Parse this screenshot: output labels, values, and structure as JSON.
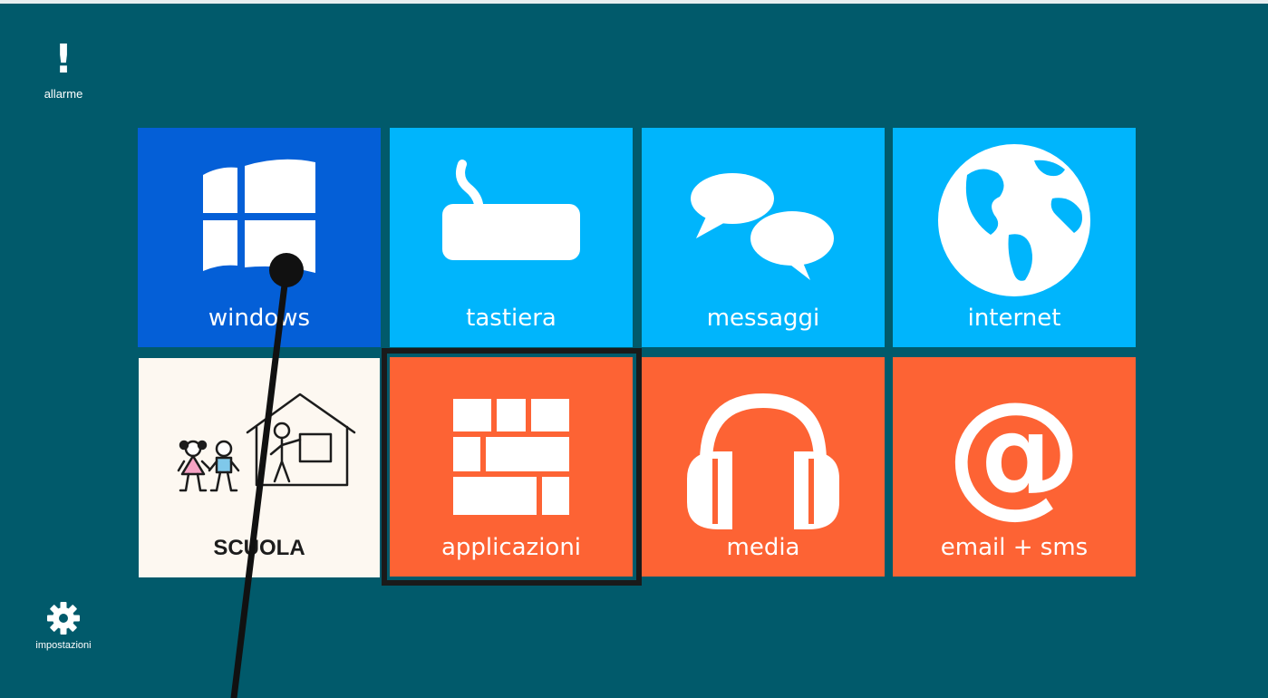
{
  "sidebar": {
    "alarm_glyph": "!",
    "alarm_label": "allarme",
    "settings_icon": "gear-icon",
    "settings_label": "impostazioni"
  },
  "tiles": [
    {
      "label": "windows",
      "icon": "windows-logo-icon",
      "color": "#045fd7"
    },
    {
      "label": "tastiera",
      "icon": "keyboard-icon",
      "color": "#00b5fc"
    },
    {
      "label": "messaggi",
      "icon": "speech-bubbles-icon",
      "color": "#00b5fc"
    },
    {
      "label": "internet",
      "icon": "globe-icon",
      "color": "#00b5fc"
    },
    {
      "label": "SCUOLA",
      "icon": "school-pictogram-icon",
      "color": "#fdf8f1"
    },
    {
      "label": "applicazioni",
      "icon": "app-grid-icon",
      "color": "#fd6334",
      "selected": true
    },
    {
      "label": "media",
      "icon": "headphones-icon",
      "color": "#fd6334"
    },
    {
      "label": "email + sms",
      "icon": "at-sign-icon",
      "color": "#fd6334"
    }
  ],
  "colors": {
    "background": "#015a6b",
    "selection_border": "#1a1a1a"
  }
}
